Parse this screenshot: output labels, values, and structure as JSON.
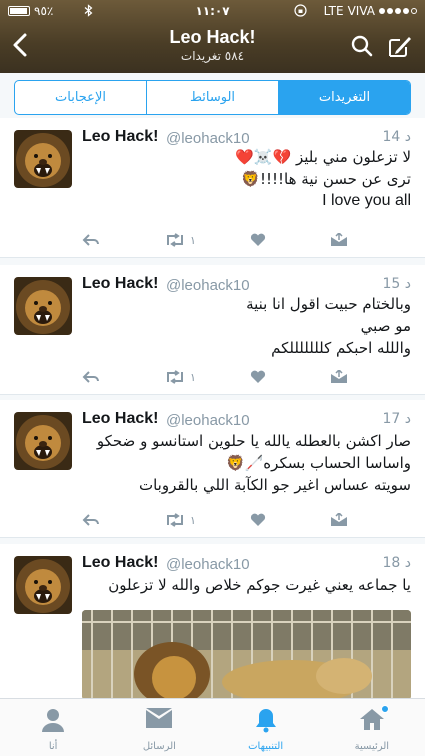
{
  "status": {
    "carrier": "VIVA",
    "network": "LTE",
    "time": "١١:٠٧",
    "battery": "٩٥٪",
    "battery_level": 0.95
  },
  "header": {
    "name": "Leo Hack!",
    "tweet_count": "٥٨٤ تغريدات"
  },
  "segments": [
    {
      "label": "الإعجابات",
      "active": false
    },
    {
      "label": "الوسائط",
      "active": false
    },
    {
      "label": "التغريدات",
      "active": true
    }
  ],
  "tweets": [
    {
      "name": "Leo Hack!",
      "handle": "@leohack10",
      "time": "14 د",
      "lines": [
        "لا تزعلون مني بليز 💔☠️❤️",
        "ترى عن حسن نية ها!!!!🦁",
        "I love you all"
      ],
      "retweets": "١"
    },
    {
      "name": "Leo Hack!",
      "handle": "@leohack10",
      "time": "15 د",
      "lines": [
        "وبالختام  حبيت اقول انا بنية",
        "مو صبي",
        "واللله احبكم كلللللللكم"
      ],
      "retweets": "١"
    },
    {
      "name": "Leo Hack!",
      "handle": "@leohack10",
      "time": "17 د",
      "lines": [
        "صار اكشن بالعطله يالله يا حلوين استانسو و ضحكو",
        "واساسا الحساب بسكره🦯🦁",
        "سويته عساس اغير جو الكآبة اللي بالقروبات"
      ],
      "retweets": "١"
    },
    {
      "name": "Leo Hack!",
      "handle": "@leohack10",
      "time": "18 د",
      "lines": [
        "يا جماعه يعني غيرت جوكم خلاص والله لا تزعلون"
      ],
      "retweets": ""
    }
  ],
  "tabbar": [
    {
      "label": "الرئيسية",
      "icon": "home-icon",
      "active": false,
      "badge": true
    },
    {
      "label": "التنبيهات",
      "icon": "bell-icon",
      "active": true,
      "badge": false
    },
    {
      "label": "الرسائل",
      "icon": "envelope-icon",
      "active": false,
      "badge": false
    },
    {
      "label": "أنا",
      "icon": "person-icon",
      "active": false,
      "badge": false
    }
  ],
  "colors": {
    "accent": "#2aa3ef",
    "header_bg": "#4a3d26",
    "gray": "#8899a6"
  }
}
